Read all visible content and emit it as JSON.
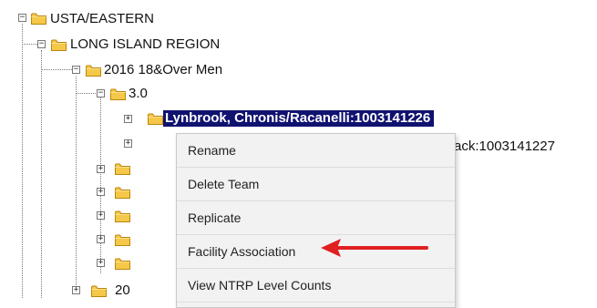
{
  "tree": {
    "root": {
      "label": "USTA/EASTERN",
      "toggle": "−"
    },
    "region": {
      "label": "LONG ISLAND REGION",
      "toggle": "−"
    },
    "league": {
      "label": "2016 18&Over Men",
      "toggle": "−"
    },
    "level": {
      "label": "3.0",
      "toggle": "−"
    },
    "teams": [
      {
        "label": "Lynbrook, Chronis/Racanelli:1003141226",
        "toggle": "+",
        "selected": true
      },
      {
        "label": "ack:1003141227",
        "toggle": "+"
      },
      {
        "label": "",
        "toggle": "+"
      },
      {
        "label": "",
        "toggle": "+"
      },
      {
        "label": "",
        "toggle": "+"
      },
      {
        "label": "",
        "toggle": "+"
      },
      {
        "label": "",
        "toggle": "+"
      }
    ],
    "next_league": {
      "label": "20",
      "toggle": "+"
    }
  },
  "context_menu": {
    "items": [
      "Rename",
      "Delete Team",
      "Replicate",
      "Facility Association",
      "View NTRP Level Counts"
    ]
  },
  "annotation": {
    "arrow_color": "#e02020",
    "points_to": "Facility Association"
  },
  "colors": {
    "selection": "#101270",
    "folder": "#f6c84a"
  }
}
